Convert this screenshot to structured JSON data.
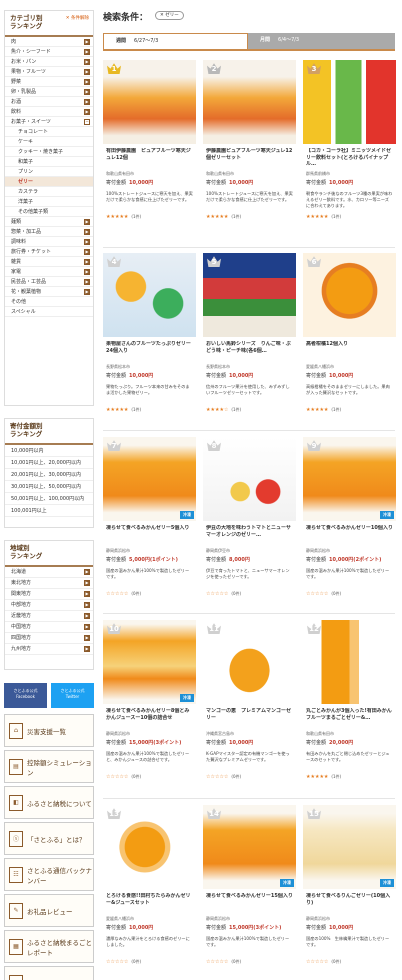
{
  "sidebar": {
    "category_title_1": "カテゴリ別",
    "category_title_2": "ランキング",
    "clear_label": "条件解除",
    "categories": [
      "肉",
      "魚介・シーフード",
      "お米・パン",
      "果物・フルーツ",
      "野菜",
      "卵・乳製品",
      "お酒",
      "飲料",
      "お菓子・スイーツ"
    ],
    "sweets_sub": [
      "チョコレート",
      "ケーキ",
      "クッキー・焼き菓子",
      "和菓子",
      "プリン",
      "ゼリー",
      "カステラ",
      "洋菓子",
      "その他菓子類"
    ],
    "categories_after": [
      "麺類",
      "惣菜・加工品",
      "調味料",
      "旅行券・チケット",
      "雑貨",
      "家電",
      "民芸品・工芸品",
      "花・観葉植物",
      "その他",
      "スペシャル"
    ],
    "amount_title_1": "寄付金額別",
    "amount_title_2": "ランキング",
    "amounts": [
      "10,000円以内",
      "10,001円以上、20,000円以内",
      "20,001円以上、30,000円以内",
      "30,001円以上、50,000円以内",
      "50,001円以上、100,000円以内",
      "100,001円以上"
    ],
    "region_title_1": "地域別",
    "region_title_2": "ランキング",
    "regions": [
      "北海道",
      "東北地方",
      "関東地方",
      "中部地方",
      "近畿地方",
      "中国地方",
      "四国地方",
      "九州地方"
    ],
    "sns": [
      {
        "top": "さとふる公式",
        "bottom": "Facebook"
      },
      {
        "top": "さとふる公式",
        "bottom": "Twitter"
      }
    ],
    "banners": [
      "災害支援一覧",
      "控除額シミュレーション",
      "ふるさと納税について",
      "「さとふる」とは？",
      "さとふる通信バックナンバー",
      "お礼品レビュー",
      "ふるさと納税まるごとレポート",
      "アンケート一覧"
    ]
  },
  "main": {
    "title": "検索条件：",
    "condition": "ゼリー",
    "tab_weekly": "週間",
    "tab_weekly_date": "6/27〜7/3",
    "tab_monthly": "月間",
    "tab_monthly_date": "6/4〜7/3",
    "frozen_label": "冷凍",
    "items": [
      {
        "rank": "1",
        "name": "有田伊藤農園　ピュアフルーツ寒天ジュレ12個",
        "area": "和歌山県有田市",
        "price_label": "寄付金額",
        "price": "10,000円",
        "desc": "100%ストレートジュースに寒天を加え、果実だけで柔らかな食感に仕上げたゼリーです。",
        "stars": "★★★★★",
        "count": "(1件)"
      },
      {
        "rank": "2",
        "name": "伊藤農園ピュアフルーツ寒天ジュレ12個ゼリーセット",
        "area": "和歌山県有田市",
        "price_label": "寄付金額",
        "price": "10,000円",
        "desc": "100%ストレートジュースに寒天を加え、果実だけで柔らかな食感に仕上げたゼリーです。",
        "stars": "★★★★★",
        "count": "(1件)"
      },
      {
        "rank": "3",
        "name": "【コカ・コーラ社】ミニッツメイドゼリー飲料セット(とろけるパイナップル…",
        "area": "群馬県前橋市",
        "price_label": "寄付金額",
        "price": "10,000円",
        "desc": "朝食やランチ後なのフルーツ3種の果実が味わえるゼリー飲料です。水、カロリー等ニーズに合わえてあります。",
        "stars": "★★★★★",
        "count": "(1件)"
      },
      {
        "rank": "4",
        "name": "果物屋さんのフルーツたっぷりゼリー24個入り",
        "area": "長野県松本市",
        "price_label": "寄付金額",
        "price": "10,000円",
        "desc": "果物たっぷり。フルーツ本来の甘みをそのまま活かした果物ゼリー。",
        "stars": "★★★★★",
        "count": "(1件)"
      },
      {
        "rank": "5",
        "name": "おいしい馬鈴シリーズ　りんご味・ぶどう味・ピーチ味(各6個…",
        "area": "長野県松本市",
        "price_label": "寄付金額",
        "price": "10,000円",
        "desc": "信州のフルーツ果汁を使用した、みずみずしいフルーツゼリーセットです。",
        "stars": "★★★★☆",
        "count": "(1件)"
      },
      {
        "rank": "6",
        "name": "高者柑橘12個入り",
        "area": "愛媛県八幡浜市",
        "price_label": "寄付金額",
        "price": "10,000円",
        "desc": "高級柑橘をそのままゼリーにしました。果肉が入った贅沢なセットです。",
        "stars": "★★★★★",
        "count": "(1件)"
      },
      {
        "rank": "7",
        "name": "凍らせて食べるみかんゼリー5個入り",
        "area": "静岡県浜松市",
        "price_label": "寄付金額",
        "price": "5,000円(1ポイント)",
        "desc": "国産の温みかん果汁100%で製造したゼリーです。",
        "stars": "☆☆☆☆☆",
        "count": "(0件)"
      },
      {
        "rank": "8",
        "name": "伊豆の大地を味わうトマトとニューサマーオレンジのゼリー…",
        "area": "静岡県伊豆市",
        "price_label": "寄付金額",
        "price": "8,000円",
        "desc": "伊豆で育ったトマトと、ニューサマーオレンジを使ったゼリーです。",
        "stars": "☆☆☆☆☆",
        "count": "(0件)"
      },
      {
        "rank": "9",
        "name": "凍らせて食べるみかんゼリー10個入り",
        "area": "静岡県浜松市",
        "price_label": "寄付金額",
        "price": "10,000円(2ポイント)",
        "desc": "国産の温みかん果汁100%で製造したゼリーです。",
        "stars": "☆☆☆☆☆",
        "count": "(0件)"
      },
      {
        "rank": "10",
        "name": "凍らせて食べるみかんゼリー8個とみかんジュースー10個の詰合せ",
        "area": "静岡県浜松市",
        "price_label": "寄付金額",
        "price": "15,000円(3ポイント)",
        "desc": "国産の温みかん果汁100%で製造したゼリーと、みかんジュースの詰合せです。",
        "stars": "☆☆☆☆☆",
        "count": "(0件)"
      },
      {
        "rank": "11",
        "name": "マンゴーの恵　プレミアムマンゴーゼリー",
        "area": "沖縄県宮古島市",
        "price_label": "寄付金額",
        "price": "10,000円",
        "desc": "K-GAPマイスター認定の有機マンゴーを使った贅沢なプレミアムゼリーです。",
        "stars": "☆☆☆☆☆",
        "count": "(0件)"
      },
      {
        "rank": "12",
        "name": "丸ごとみかんが3個入った!有田みかんフルーツまるごとゼリー&…",
        "area": "和歌山県有田市",
        "price_label": "寄付金額",
        "price": "20,000円",
        "desc": "有田みかんを丸ごと閉じ込めたゼリーとジュースのセットです。",
        "stars": "★★★★★",
        "count": "(1件)"
      },
      {
        "rank": "13",
        "name": "とろける食感!!田村ちたらみかんゼリー&ジュースセット",
        "area": "愛媛県八幡浜市",
        "price_label": "寄付金額",
        "price": "10,000円",
        "desc": "濃厚なみかん果汁をとろける食感のゼリーにしました。",
        "stars": "☆☆☆☆☆",
        "count": "(0件)"
      },
      {
        "rank": "14",
        "name": "凍らせて食べるみかんゼリー15個入り",
        "area": "静岡県浜松市",
        "price_label": "寄付金額",
        "price": "15,000円(3ポイント)",
        "desc": "国産の温みかん果汁100%で製造したゼリーです。",
        "stars": "☆☆☆☆☆",
        "count": "(0件)"
      },
      {
        "rank": "15",
        "name": "凍らせて食べるりんごゼリー(10個入り)",
        "area": "静岡県浜松市",
        "price_label": "寄付金額",
        "price": "10,000円",
        "desc": "国産の100%　生林檎果汁で製造したゼリーです。",
        "stars": "☆☆☆☆☆",
        "count": "(0件)"
      }
    ]
  },
  "colors": {
    "accent": "#c98a4b",
    "price": "#c0392b",
    "star": "#e67e22",
    "gold": "#e8b923",
    "silver": "#b9b9b9",
    "bronze": "#d1a063"
  }
}
